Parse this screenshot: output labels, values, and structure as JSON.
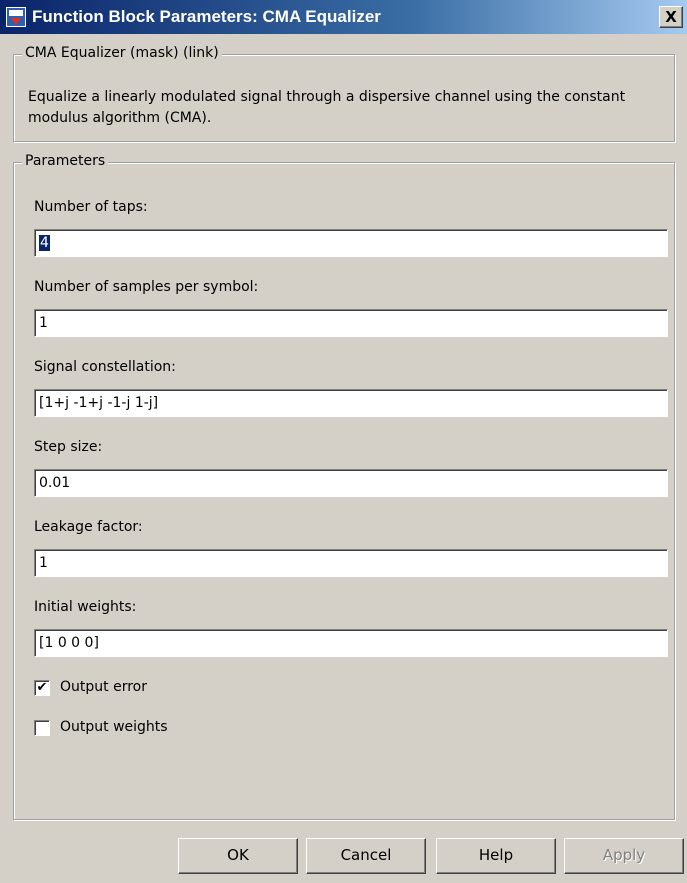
{
  "window": {
    "title": "Function Block Parameters: CMA Equalizer",
    "close_label": "X"
  },
  "description_group": {
    "legend": "CMA Equalizer (mask) (link)",
    "text": "Equalize a linearly modulated signal through a dispersive channel using the constant modulus algorithm (CMA)."
  },
  "parameters_group": {
    "legend": "Parameters",
    "fields": [
      {
        "label": "Number of taps:",
        "value": "4"
      },
      {
        "label": "Number of samples per symbol:",
        "value": "1"
      },
      {
        "label": "Signal constellation:",
        "value": "[1+j -1+j -1-j 1-j]"
      },
      {
        "label": "Step size:",
        "value": "0.01"
      },
      {
        "label": "Leakage factor:",
        "value": "1"
      },
      {
        "label": "Initial weights:",
        "value": "[1 0 0 0]"
      }
    ],
    "checkboxes": [
      {
        "label": "Output error",
        "checked": true,
        "mark": "✔"
      },
      {
        "label": "Output weights",
        "checked": false,
        "mark": ""
      }
    ]
  },
  "buttons": {
    "ok": "OK",
    "cancel": "Cancel",
    "help": "Help",
    "apply": "Apply"
  }
}
